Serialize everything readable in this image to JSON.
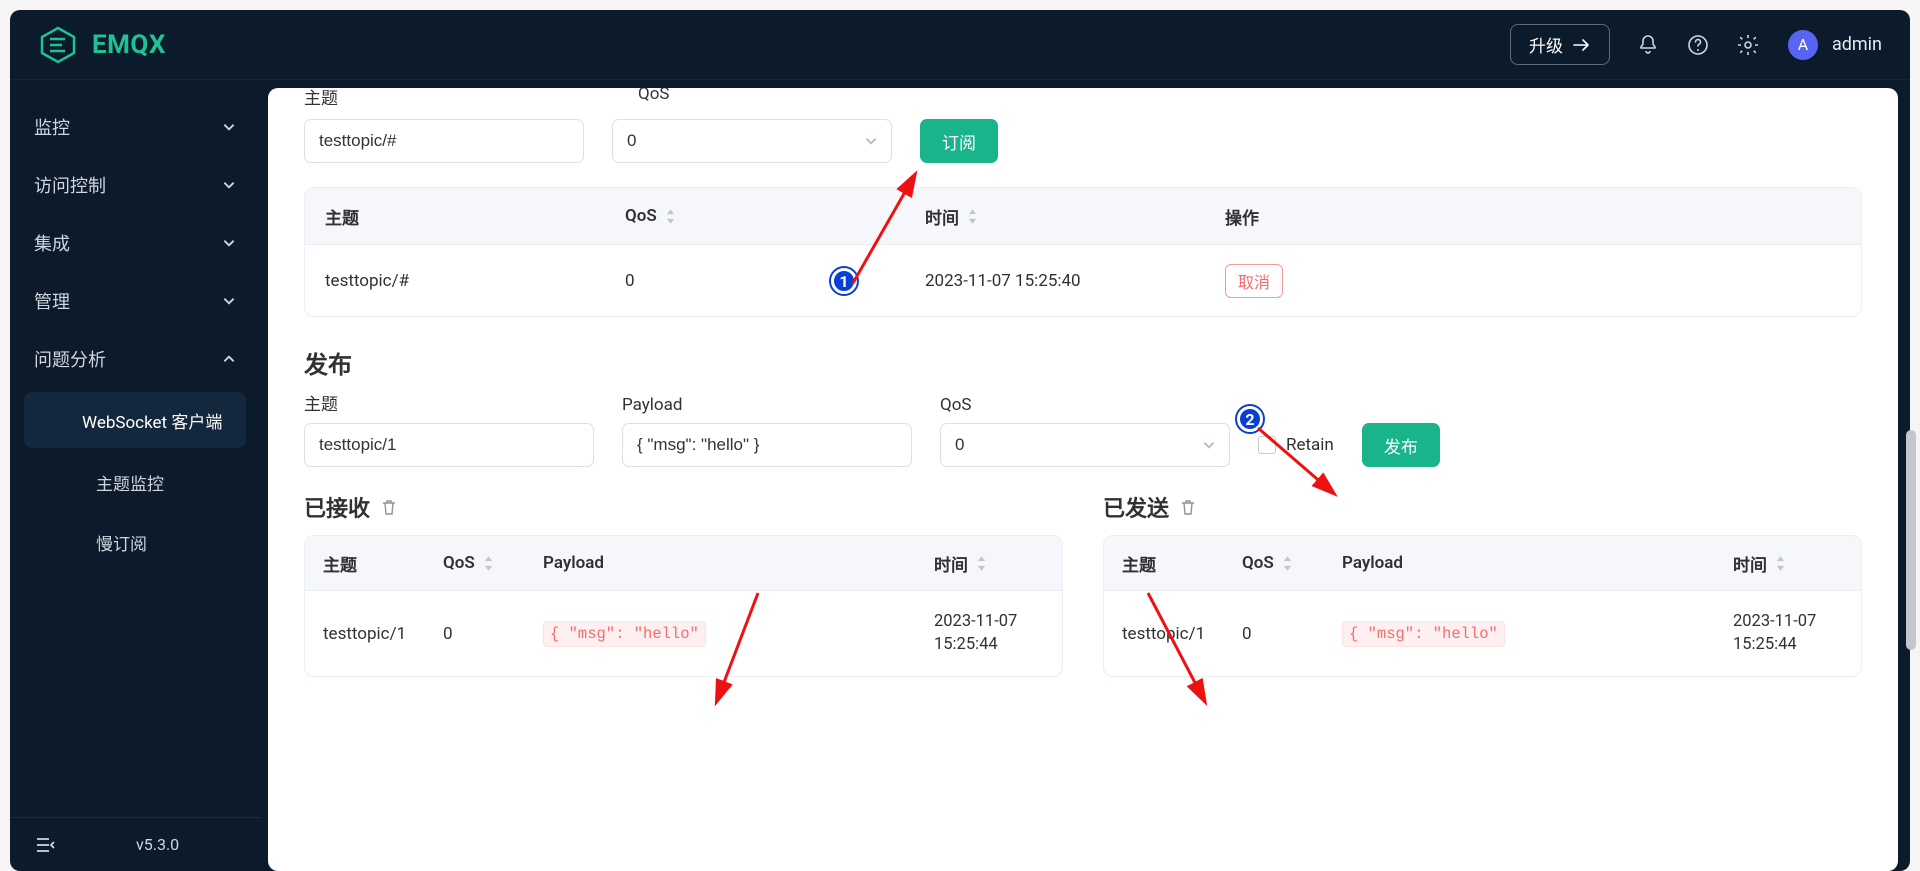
{
  "brand": {
    "name": "EMQX",
    "avatar_letter": "A"
  },
  "header": {
    "upgrade_label": "升级",
    "username": "admin"
  },
  "sidebar": {
    "items": [
      {
        "label": "监控",
        "expanded": false
      },
      {
        "label": "访问控制",
        "expanded": false
      },
      {
        "label": "集成",
        "expanded": false
      },
      {
        "label": "管理",
        "expanded": false
      },
      {
        "label": "问题分析",
        "expanded": true
      }
    ],
    "sub_items": [
      {
        "label": "WebSocket 客户端",
        "active": true
      },
      {
        "label": "主题监控",
        "active": false
      },
      {
        "label": "慢订阅",
        "active": false
      }
    ],
    "version": "v5.3.0"
  },
  "subscribe": {
    "topic_label": "主题",
    "qos_label": "QoS",
    "topic_value": "testtopic/#",
    "qos_value": "0",
    "button": "订阅",
    "table": {
      "cols": {
        "topic": "主题",
        "qos": "QoS",
        "time": "时间",
        "op": "操作"
      },
      "rows": [
        {
          "topic": "testtopic/#",
          "qos": "0",
          "time": "2023-11-07 15:25:40",
          "op": "取消"
        }
      ]
    }
  },
  "publish": {
    "section_title": "发布",
    "topic_label": "主题",
    "payload_label": "Payload",
    "qos_label": "QoS",
    "topic_value": "testtopic/1",
    "payload_value": "{ \"msg\": \"hello\" }",
    "qos_value": "0",
    "retain_label": "Retain",
    "button": "发布"
  },
  "received": {
    "title": "已接收",
    "cols": {
      "topic": "主题",
      "qos": "QoS",
      "payload": "Payload",
      "time": "时间"
    },
    "rows": [
      {
        "topic": "testtopic/1",
        "qos": "0",
        "payload": "{ \"msg\": \"hello\"",
        "time": "2023-11-07 15:25:44"
      }
    ]
  },
  "sent": {
    "title": "已发送",
    "cols": {
      "topic": "主题",
      "qos": "QoS",
      "payload": "Payload",
      "time": "时间"
    },
    "rows": [
      {
        "topic": "testtopic/1",
        "qos": "0",
        "payload": "{ \"msg\": \"hello\"",
        "time": "2023-11-07 15:25:44"
      }
    ]
  },
  "annotations": {
    "one": "1",
    "two": "2"
  }
}
